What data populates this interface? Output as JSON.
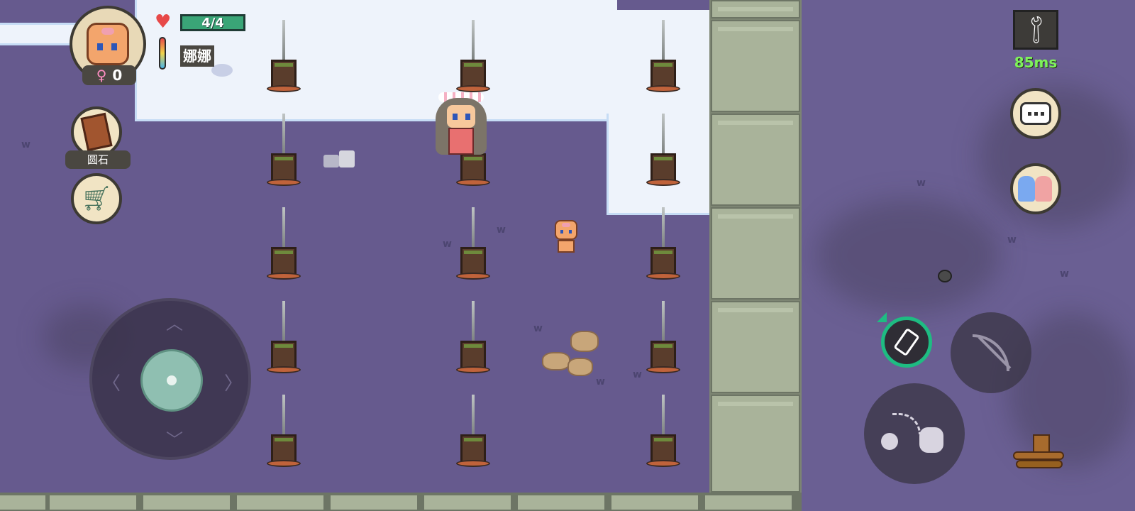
{
  "player": {
    "health_text": "4/4",
    "name": "娜娜",
    "gender_symbol": "♀",
    "gender_count": "0"
  },
  "inventory": {
    "held_item_label": "圆石"
  },
  "network": {
    "ping": "85ms"
  },
  "icons": {
    "avatar": "baby-avatar-icon",
    "heart": "heart-icon",
    "thermometer": "thermometer-icon",
    "held_item": "journal-icon",
    "shop": "shopping-cart-icon",
    "settings": "wrench-icon",
    "chat": "chat-bubble-icon",
    "friends": "friends-icon",
    "bottle": "bottle-icon",
    "bow": "bow-icon",
    "throw": "throw-icon",
    "logs": "firewood-icon"
  },
  "colors": {
    "ground": "#665a8e",
    "snow": "#eef3fb",
    "wall": "#a9b39a",
    "health_bar": "#3aa577",
    "ping": "#7ef25a",
    "accent_green": "#1ebc82"
  }
}
